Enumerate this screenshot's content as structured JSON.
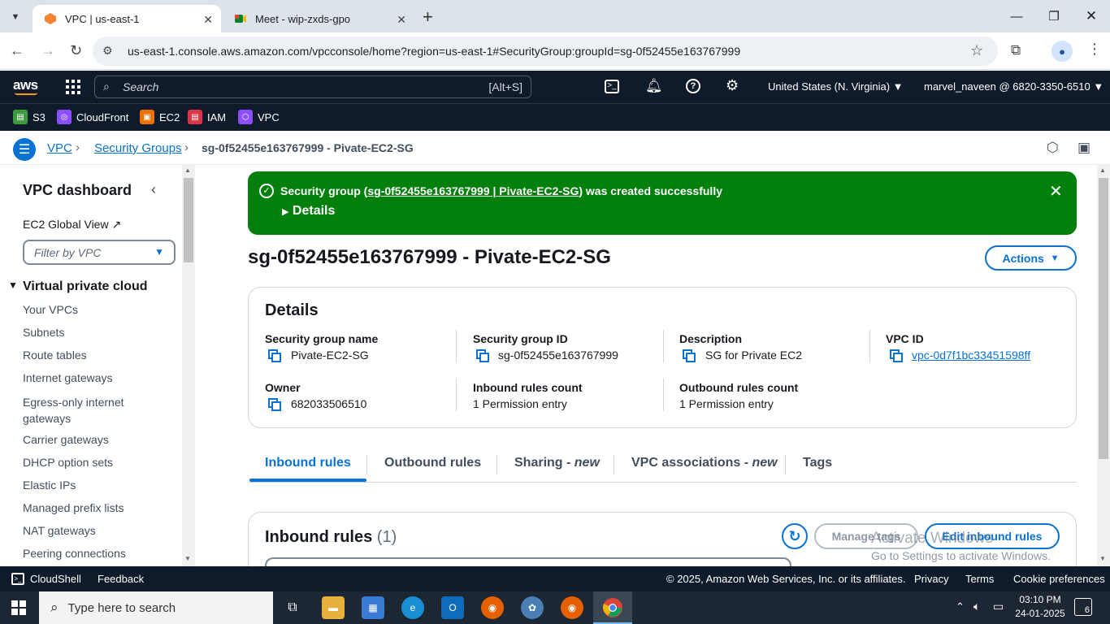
{
  "browser": {
    "tabs": [
      {
        "title": "VPC | us-east-1",
        "active": true
      },
      {
        "title": "Meet - wip-zxds-gpo",
        "active": false
      }
    ],
    "url": "us-east-1.console.aws.amazon.com/vpcconsole/home?region=us-east-1#SecurityGroup:groupId=sg-0f52455e163767999"
  },
  "aws_header": {
    "logo": "aws",
    "search_placeholder": "Search",
    "search_shortcut": "[Alt+S]",
    "region": "United States (N. Virginia) ▼",
    "account": "marvel_naveen @ 6820-3350-6510 ▼",
    "favorites": [
      "S3",
      "CloudFront",
      "EC2",
      "IAM",
      "VPC"
    ]
  },
  "breadcrumb": {
    "items": [
      "VPC",
      "Security Groups"
    ],
    "current": "sg-0f52455e163767999 - Pivate-EC2-SG"
  },
  "sidebar": {
    "title": "VPC dashboard",
    "global_view": "EC2 Global View",
    "filter_placeholder": "Filter by VPC",
    "section": "Virtual private cloud",
    "items": [
      "Your VPCs",
      "Subnets",
      "Route tables",
      "Internet gateways",
      "Egress-only internet gateways",
      "Carrier gateways",
      "DHCP option sets",
      "Elastic IPs",
      "Managed prefix lists",
      "NAT gateways",
      "Peering connections"
    ]
  },
  "flash": {
    "prefix": "Security group (",
    "link": "sg-0f52455e163767999 | Pivate-EC2-SG",
    "suffix": ") was created successfully",
    "details": "Details"
  },
  "page": {
    "title": "sg-0f52455e163767999 - Pivate-EC2-SG",
    "actions": "Actions"
  },
  "details": {
    "heading": "Details",
    "sg_name_label": "Security group name",
    "sg_name": "Pivate-EC2-SG",
    "sg_id_label": "Security group ID",
    "sg_id": "sg-0f52455e163767999",
    "desc_label": "Description",
    "desc": "SG for Private EC2",
    "vpc_label": "VPC ID",
    "vpc": "vpc-0d7f1bc33451598ff",
    "owner_label": "Owner",
    "owner": "682033506510",
    "inbound_label": "Inbound rules count",
    "inbound": "1 Permission entry",
    "outbound_label": "Outbound rules count",
    "outbound": "1 Permission entry"
  },
  "tabs": [
    {
      "label": "Inbound rules",
      "suffix": ""
    },
    {
      "label": "Outbound rules",
      "suffix": ""
    },
    {
      "label": "Sharing - ",
      "suffix": "new"
    },
    {
      "label": "VPC associations - ",
      "suffix": "new"
    },
    {
      "label": "Tags",
      "suffix": ""
    }
  ],
  "inbound": {
    "title": "Inbound rules",
    "count": "(1)",
    "manage_tags": "Manage tags",
    "edit": "Edit inbound rules"
  },
  "watermark": {
    "line1": "Activate Windows",
    "line2": "Go to Settings to activate Windows."
  },
  "footer": {
    "cloudshell": "CloudShell",
    "feedback": "Feedback",
    "copyright": "© 2025, Amazon Web Services, Inc. or its affiliates.",
    "privacy": "Privacy",
    "terms": "Terms",
    "cookies": "Cookie preferences"
  },
  "taskbar": {
    "search_placeholder": "Type here to search",
    "time": "03:10 PM",
    "date": "24-01-2025",
    "notifications": "6"
  }
}
